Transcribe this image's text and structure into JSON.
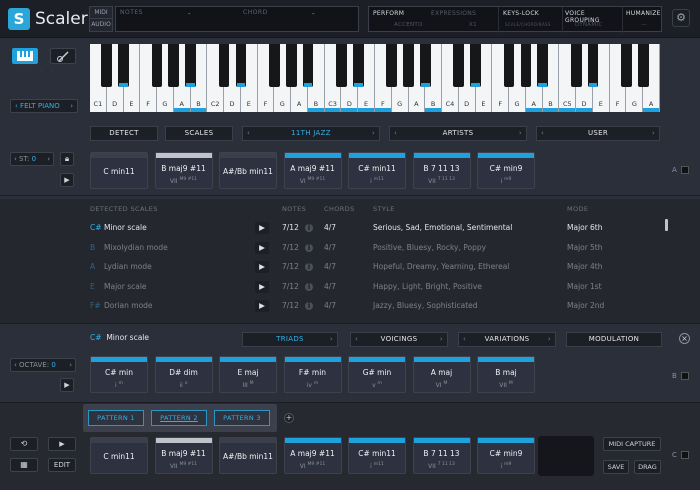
{
  "app": {
    "name": "Scaler",
    "logo_letter": "S"
  },
  "top": {
    "midi": "MIDI",
    "audio": "AUDIO",
    "notes_label": "NOTES",
    "notes_value": "-",
    "chord_label": "CHORD",
    "chord_value": "-"
  },
  "perf": {
    "perform": "PERFORM",
    "expressions": "EXPRESSIONS",
    "keys_lock": "KEYS-LOCK",
    "voice_grouping": "VOICE GROUPING",
    "humanize": "HUMANIZE",
    "accento": "ACCENTO",
    "x1": "X1",
    "keys_sub": "SCALE/CHORD/BASS",
    "dynamic": "DYNAMIC",
    "hum_val": "—"
  },
  "left": {
    "instrument": "FELT PIANO",
    "st_label": "ST:",
    "st_value": "0",
    "octave_label": "OCTAVE:",
    "octave_value": "0"
  },
  "keyboard": {
    "labels": [
      "C1",
      "D",
      "E",
      "F",
      "G",
      "A",
      "B",
      "C2",
      "D",
      "E",
      "F",
      "G",
      "A",
      "B",
      "C3",
      "D",
      "E",
      "F",
      "G",
      "A",
      "B",
      "C4",
      "D",
      "E",
      "F",
      "G",
      "A",
      "B",
      "C5",
      "D",
      "E",
      "F",
      "G",
      "A"
    ]
  },
  "row_tabs": {
    "detect": "DETECT",
    "scales": "SCALES",
    "jazz": "11TH JAZZ",
    "artists": "ARTISTS",
    "user": "USER"
  },
  "chords_top": [
    {
      "name": "C min11",
      "num": ""
    },
    {
      "name": "B maj9 #11",
      "num": "VII",
      "sup": "M9 #11"
    },
    {
      "name": "A#/Bb min11",
      "num": ""
    },
    {
      "name": "A maj9 #11",
      "num": "VI",
      "sup": "M9 #11"
    },
    {
      "name": "C# min11",
      "num": "i",
      "sup": "m11"
    },
    {
      "name": "B 7 11 13",
      "num": "VII",
      "sup": "7 11 13"
    },
    {
      "name": "C# min9",
      "num": "i",
      "sup": "m9"
    }
  ],
  "side_letters": {
    "a": "A",
    "b": "B",
    "c": "C"
  },
  "scales": {
    "headers": {
      "detected": "DETECTED SCALES",
      "notes": "NOTES",
      "chords": "CHORDS",
      "style": "STYLE",
      "mode": "MODE"
    },
    "rows": [
      {
        "key": "C#",
        "name": "Minor scale",
        "notes": "7/12",
        "chords": "4/7",
        "style": "Serious, Sad, Emotional, Sentimental",
        "mode": "Major",
        "degree": "6th"
      },
      {
        "key": "B",
        "name": "Mixolydian mode",
        "notes": "7/12",
        "chords": "4/7",
        "style": "Positive, Bluesy, Rocky, Poppy",
        "mode": "Major",
        "degree": "5th"
      },
      {
        "key": "A",
        "name": "Lydian mode",
        "notes": "7/12",
        "chords": "4/7",
        "style": "Hopeful, Dreamy, Yearning, Ethereal",
        "mode": "Major",
        "degree": "4th"
      },
      {
        "key": "E",
        "name": "Major scale",
        "notes": "7/12",
        "chords": "4/7",
        "style": "Happy, Light, Bright, Positive",
        "mode": "Major",
        "degree": "1st"
      },
      {
        "key": "F#",
        "name": "Dorian mode",
        "notes": "7/12",
        "chords": "4/7",
        "style": "Jazzy, Bluesy, Sophisticated",
        "mode": "Major",
        "degree": "2nd"
      }
    ]
  },
  "scale_sel": {
    "key": "C#",
    "name": "Minor scale"
  },
  "mid_tabs": {
    "triads": "TRIADS",
    "voicings": "VOICINGS",
    "variations": "VARIATIONS",
    "modulation": "MODULATION",
    "close": "×"
  },
  "chords_mid": [
    {
      "name": "C# min",
      "num": "i",
      "sup": "m"
    },
    {
      "name": "D# dim",
      "num": "ii",
      "sup": "o"
    },
    {
      "name": "E maj",
      "num": "III",
      "sup": "M"
    },
    {
      "name": "F# min",
      "num": "iv",
      "sup": "m"
    },
    {
      "name": "G# min",
      "num": "v",
      "sup": "m"
    },
    {
      "name": "A maj",
      "num": "VI",
      "sup": "M"
    },
    {
      "name": "B maj",
      "num": "VII",
      "sup": "M"
    }
  ],
  "patterns": [
    "PATTERN 1",
    "PATTERN 2",
    "PATTERN 3"
  ],
  "bottom": {
    "edit": "EDIT",
    "midi_capture": "MIDI CAPTURE",
    "save": "SAVE",
    "drag": "DRAG",
    "plus": "+"
  },
  "colors": {
    "accent": "#1fa1de"
  }
}
